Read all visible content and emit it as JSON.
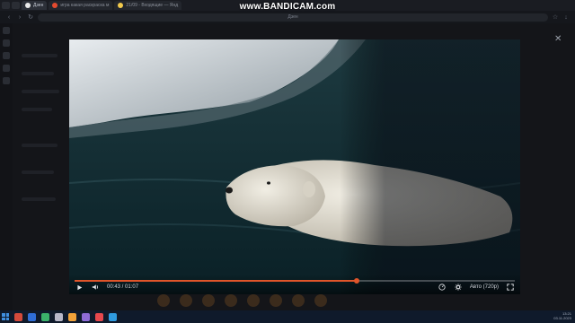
{
  "watermark": "www.BANDICAM.com",
  "browser": {
    "tabs": [
      {
        "label": "Дзен",
        "fav": "#e9e9e9",
        "active": true
      },
      {
        "label": "игра какая раскраска м",
        "fav": "#e34a2f",
        "active": false
      },
      {
        "label": "21/09 - Входящие — Янд",
        "fav": "#f2c94c",
        "active": false
      }
    ],
    "url": "Дзен"
  },
  "player": {
    "current_time": "00:43",
    "duration": "01:07",
    "time_separator": " / ",
    "quality": "Авто (720p)",
    "progress_fraction": 0.64
  },
  "taskbar": {
    "time": "13:21",
    "date": "03.11.2023",
    "icon_colors": [
      "#d24a3b",
      "#2f6ed8",
      "#3bb16b",
      "#b7b7c8",
      "#f0a23a",
      "#8e6cd8",
      "#e5484d",
      "#2f9be0"
    ]
  }
}
